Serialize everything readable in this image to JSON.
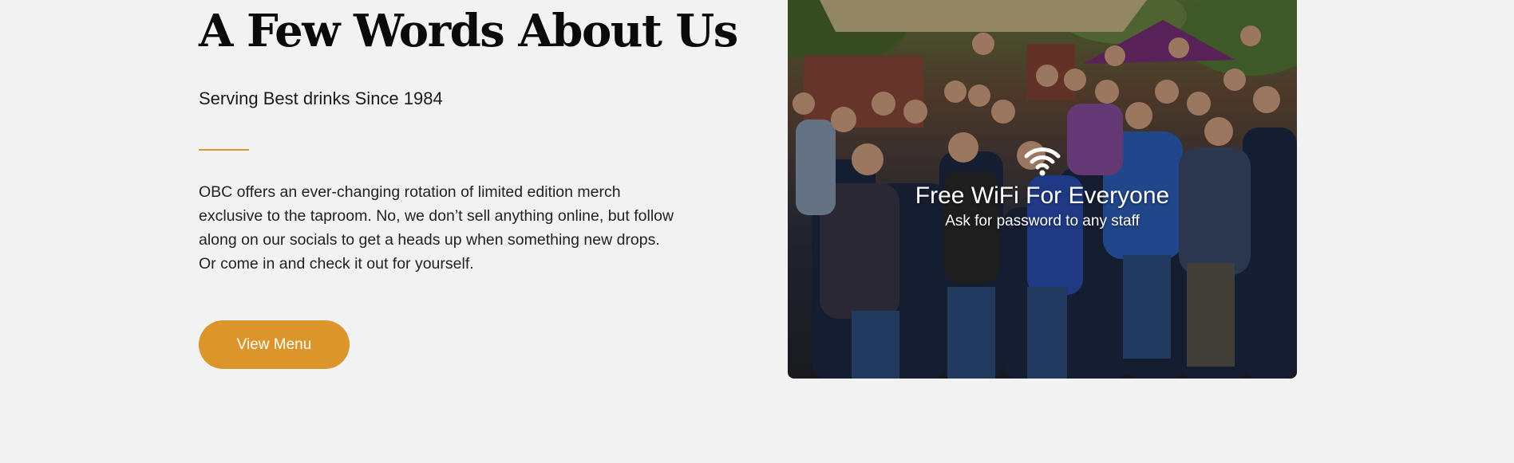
{
  "about": {
    "heading": "A Few Words About Us",
    "subheading": "Serving Best drinks Since 1984",
    "body": "OBC offers an ever-changing rotation of limited edition merch exclusive to the taproom. No, we don’t sell anything online, but follow along on our socials to get a heads up when something new drops. Or come in and check it out for yourself.",
    "button_label": "View Menu"
  },
  "photo": {
    "wifi_icon": "wifi-icon",
    "title": "Free WiFi For Everyone",
    "subtitle": "Ask for password to any staff"
  },
  "colors": {
    "accent": "#dc952a",
    "background": "#f2f2f2",
    "heading": "#0a0a0a",
    "text": "#222222"
  }
}
